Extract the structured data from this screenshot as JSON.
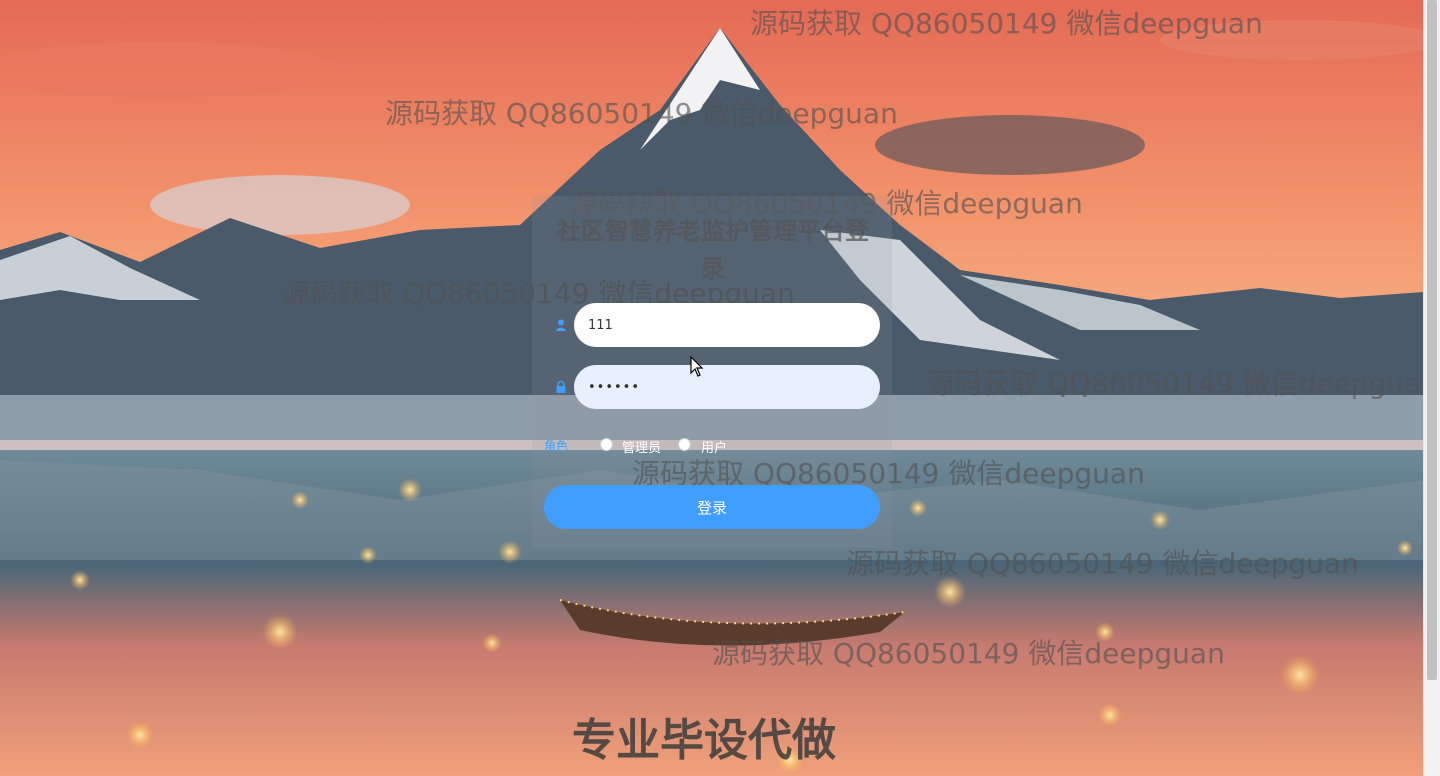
{
  "login": {
    "title": "社区智慧养老监护管理平台登录",
    "username_value": "111",
    "password_value": "••••••",
    "role_label": "角色",
    "roles": [
      "管理员",
      "用户"
    ],
    "submit_label": "登录"
  },
  "watermark": {
    "text": "源码获取 QQ86050149 微信deepguan",
    "text_truncated": "源码获取 QQ86050149 微信deepgua"
  },
  "banner": {
    "text": "专业毕设代做"
  },
  "colors": {
    "primary": "#409eff",
    "input_bg": "#ffffff",
    "password_bg": "#e8f0fe"
  }
}
